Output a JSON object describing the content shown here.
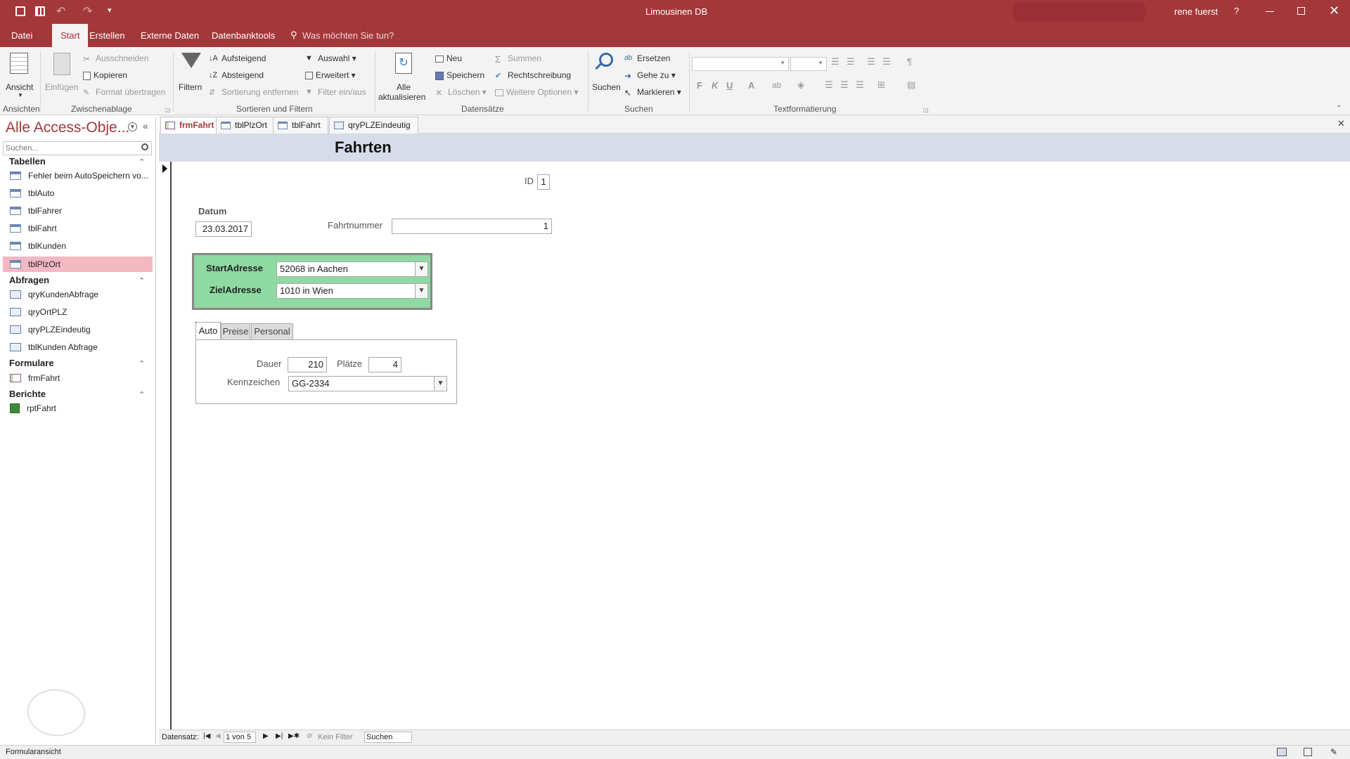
{
  "app": {
    "title": "Limousinen DB",
    "user": "rene fuerst",
    "help": "?"
  },
  "quickaccess": {
    "save": "save-icon",
    "grid": "grid-icon",
    "undo": "undo-icon",
    "redo": "redo-icon",
    "more": "▾"
  },
  "ribbon_tabs": [
    "Datei",
    "Start",
    "Erstellen",
    "Externe Daten",
    "Datenbanktools"
  ],
  "tellme": "Was möchten Sie tun?",
  "ribbon": {
    "ansicht": "Ansicht",
    "einfuegen": "Einfügen",
    "ausschneiden": "Ausschneiden",
    "kopieren": "Kopieren",
    "format": "Format übertragen",
    "filtern": "Filtern",
    "aufsteigend": "Aufsteigend",
    "absteigend": "Absteigend",
    "sortierung": "Sortierung entfernen",
    "auswahl": "Auswahl",
    "erweitert": "Erweitert",
    "filterein": "Filter ein/aus",
    "alle1": "Alle",
    "alle2": "aktualisieren",
    "neu": "Neu",
    "speichern": "Speichern",
    "loeschen": "Löschen",
    "summen": "Summen",
    "rechtschreibung": "Rechtschreibung",
    "weitere": "Weitere Optionen",
    "suchen": "Suchen",
    "ersetzen": "Ersetzen",
    "gehezu": "Gehe zu",
    "markieren": "Markieren",
    "bold": "F",
    "italic": "K",
    "underline": "U",
    "fontcolor": "A",
    "groups": [
      "Ansichten",
      "Zwischenablage",
      "Sortieren und Filtern",
      "Datensätze",
      "Suchen",
      "Textformatierung"
    ]
  },
  "nav": {
    "title": "Alle Access-Obje...",
    "search_placeholder": "Suchen...",
    "sections": [
      {
        "name": "Tabellen",
        "items": [
          "Fehler beim AutoSpeichern vo...",
          "tblAuto",
          "tblFahrer",
          "tblFahrt",
          "tblKunden",
          "tblPlzOrt"
        ]
      },
      {
        "name": "Abfragen",
        "items": [
          "qryKundenAbfrage",
          "qryOrtPLZ",
          "qryPLZEindeutig",
          "tblKunden Abfrage"
        ]
      },
      {
        "name": "Formulare",
        "items": [
          "frmFahrt"
        ]
      },
      {
        "name": "Berichte",
        "items": [
          "rptFahrt"
        ]
      }
    ]
  },
  "doctabs": [
    "frmFahrt",
    "tblPlzOrt",
    "tblFahrt",
    "qryPLZEindeutig"
  ],
  "form": {
    "title": "Fahrten",
    "id_label": "ID",
    "id_value": "1",
    "datum_label": "Datum",
    "datum_value": "23.03.2017",
    "fahrtnummer_label": "Fahrtnummer",
    "fahrtnummer_value": "1",
    "start_label": "StartAdresse",
    "start_value": "52068 in Aachen",
    "ziel_label": "ZielAdresse",
    "ziel_value": "1010 in Wien",
    "tabs": [
      "Auto",
      "Preise",
      "Personal"
    ],
    "dauer_label": "Dauer",
    "dauer_value": "210",
    "plaetze_label": "Plätze",
    "plaetze_value": "4",
    "kennzeichen_label": "Kennzeichen",
    "kennzeichen_value": "GG-2334",
    "green": "#8fd9a2"
  },
  "recnav": {
    "label": "Datensatz:",
    "pos": "1 von 5",
    "filter": "Kein Filter",
    "search": "Suchen"
  },
  "status": {
    "text": "Formularansicht"
  }
}
